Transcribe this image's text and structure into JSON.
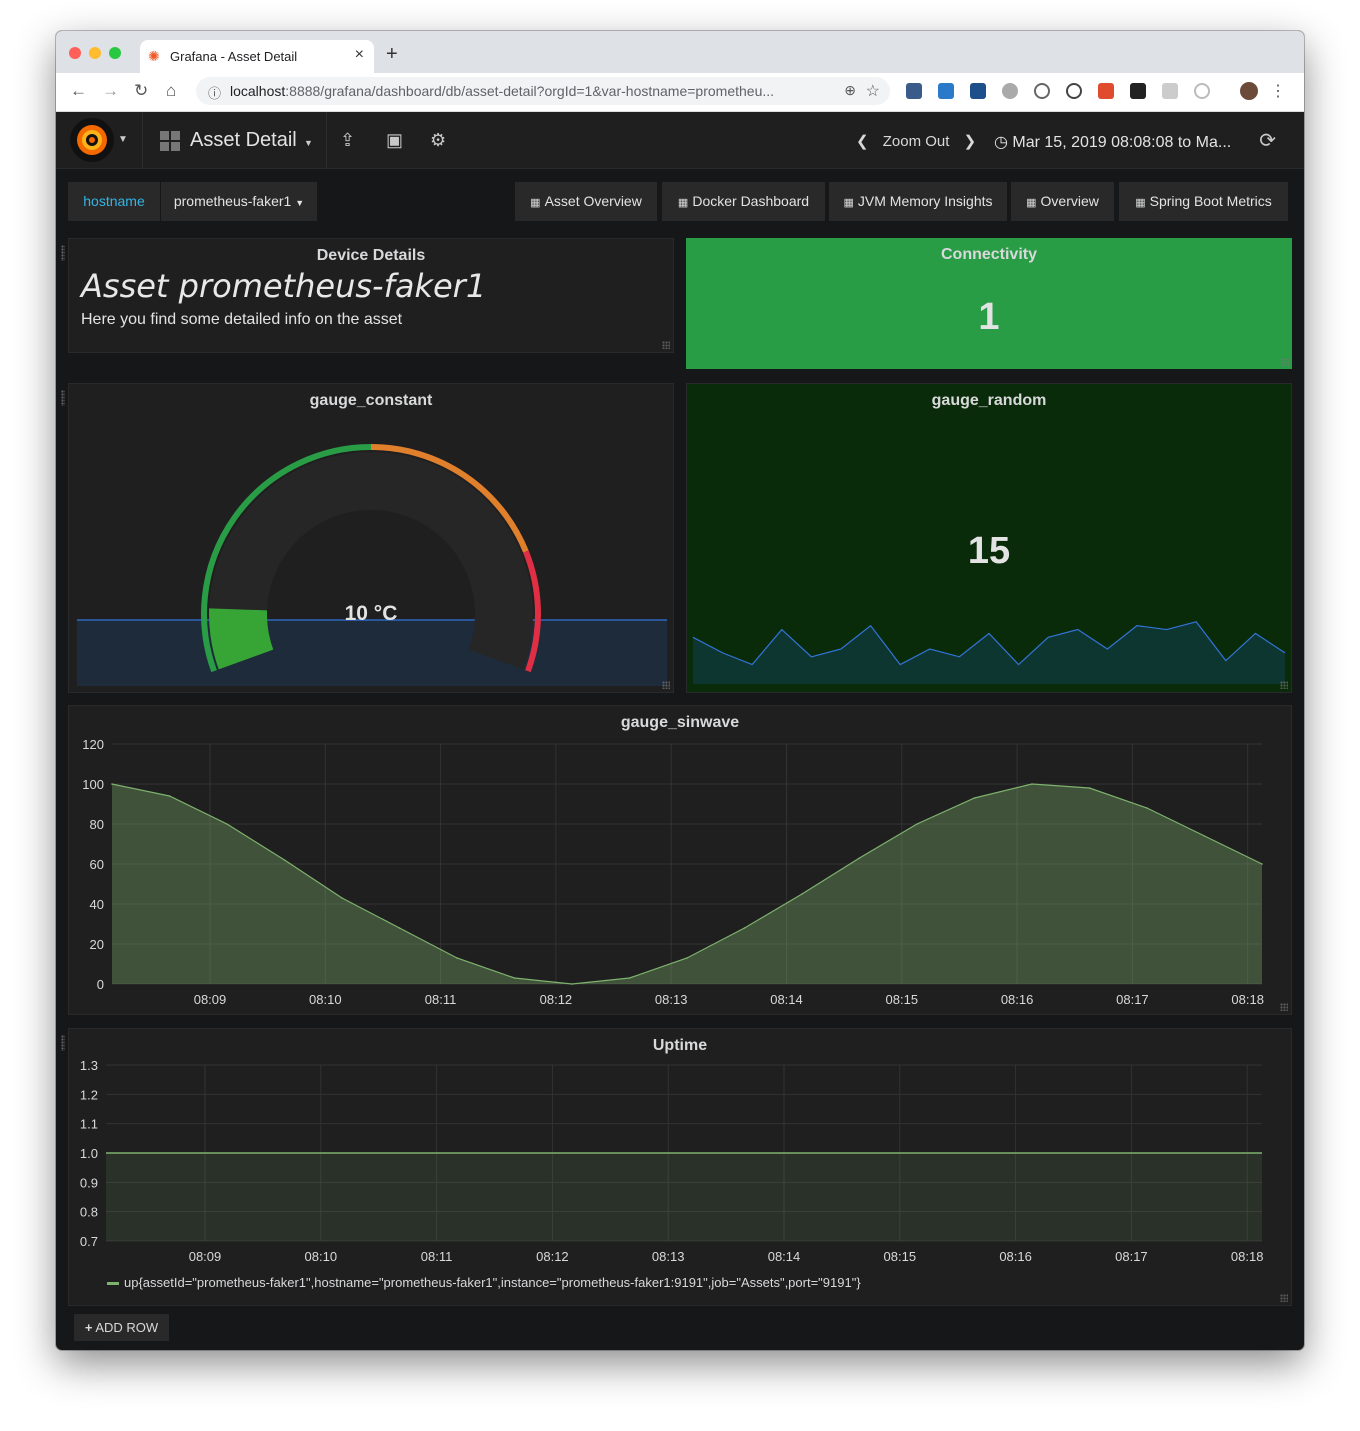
{
  "browser": {
    "tab_title": "Grafana - Asset Detail",
    "url_host": "localhost",
    "url_rest": ":8888/grafana/dashboard/db/asset-detail?orgId=1&var-hostname=prometheu..."
  },
  "navbar": {
    "dashboard_title": "Asset Detail",
    "zoom_out": "Zoom Out",
    "time_range": "Mar 15, 2019 08:08:08 to Ma..."
  },
  "variables": {
    "label": "hostname",
    "value": "prometheus-faker1"
  },
  "dashboard_links": [
    "Asset Overview",
    "Docker Dashboard",
    "JVM Memory Insights",
    "Overview",
    "Spring Boot Metrics"
  ],
  "panels": {
    "device_details": {
      "title": "Device Details",
      "heading": "Asset prometheus-faker1",
      "text": "Here you find some detailed info on the asset"
    },
    "connectivity": {
      "title": "Connectivity",
      "value": "1",
      "color": "#299c46"
    },
    "gauge_constant": {
      "title": "gauge_constant",
      "value_text": "10 °C",
      "value": 10,
      "min": 0,
      "max": 100,
      "threshold_colors": [
        "#299c46",
        "#e07f2c",
        "#e02f44"
      ]
    },
    "gauge_random": {
      "title": "gauge_random",
      "value": "15",
      "background": "#0a2b0a"
    }
  },
  "chart_data": [
    {
      "type": "area",
      "title": "gauge_sinwave",
      "x": [
        "08:08",
        "08:08:30",
        "08:09",
        "08:09:30",
        "08:10",
        "08:10:30",
        "08:11",
        "08:11:30",
        "08:12",
        "08:12:30",
        "08:13",
        "08:13:30",
        "08:14",
        "08:14:30",
        "08:15",
        "08:15:30",
        "08:16",
        "08:16:30",
        "08:17",
        "08:17:30",
        "08:18"
      ],
      "x_ticks": [
        "08:09",
        "08:10",
        "08:11",
        "08:12",
        "08:13",
        "08:14",
        "08:15",
        "08:16",
        "08:17",
        "08:18"
      ],
      "y_ticks": [
        "120",
        "100",
        "80",
        "60",
        "40",
        "20",
        "0"
      ],
      "ylim": [
        0,
        120
      ],
      "values": [
        100,
        94,
        80,
        62,
        43,
        28,
        13,
        3,
        0,
        3,
        13,
        28,
        45,
        63,
        80,
        93,
        100,
        98,
        88,
        74,
        60
      ],
      "color": "#7eb26d",
      "grid": true
    },
    {
      "type": "line",
      "title": "Uptime",
      "x_ticks": [
        "08:09",
        "08:10",
        "08:11",
        "08:12",
        "08:13",
        "08:14",
        "08:15",
        "08:16",
        "08:17",
        "08:18"
      ],
      "y_ticks": [
        "1.3",
        "1.2",
        "1.1",
        "1.0",
        "0.9",
        "0.8",
        "0.7"
      ],
      "ylim": [
        0.7,
        1.3
      ],
      "series": [
        {
          "name": "up{assetId=\"prometheus-faker1\",hostname=\"prometheus-faker1\",instance=\"prometheus-faker1:9191\",job=\"Assets\",port=\"9191\"}",
          "value": 1.0
        }
      ],
      "color": "#7eb26d",
      "grid": true
    }
  ],
  "sparkline_random": [
    12,
    8,
    5,
    14,
    7,
    9,
    15,
    5,
    9,
    7,
    13,
    5,
    12,
    14,
    9,
    15,
    14,
    16,
    6,
    13,
    8
  ],
  "add_row": "ADD ROW"
}
